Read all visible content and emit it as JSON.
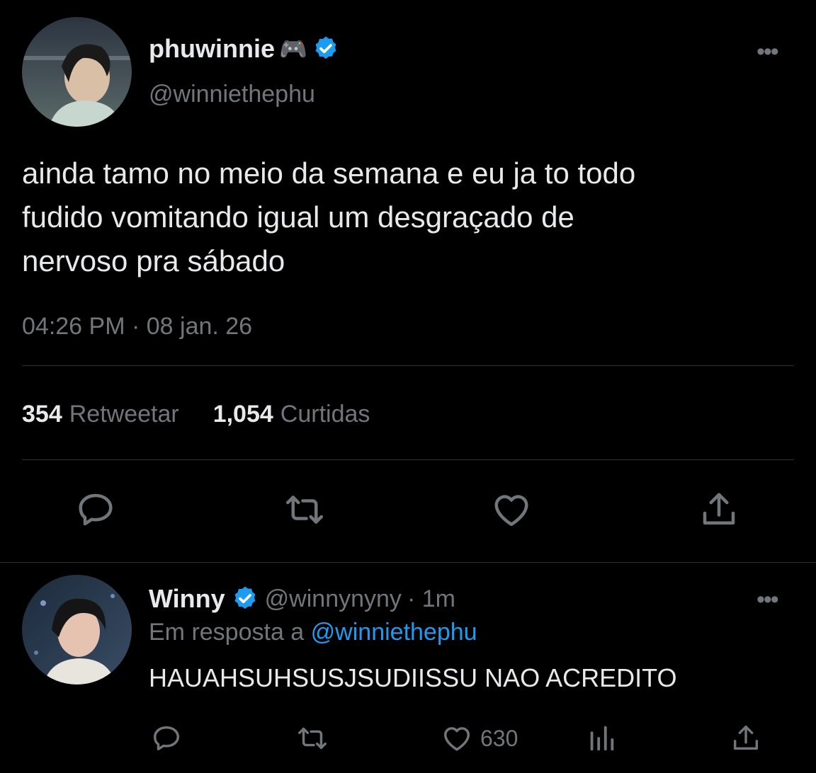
{
  "tweet": {
    "author_name": "phuwinnie",
    "author_emoji": "🎮",
    "author_handle": "@winniethephu",
    "text_line1": "ainda tamo no meio da semana e eu ja to todo",
    "text_line2": "fudido vomitando igual um desgraçado de",
    "text_line3": "nervoso pra sábado",
    "timestamp": "04:26 PM · 08 jan. 26",
    "retweets_count": "354",
    "retweets_label": "Retweetar",
    "likes_count": "1,054",
    "likes_label": "Curtidas",
    "icons": {
      "reply": "reply-icon",
      "retweet": "retweet-icon",
      "like": "heart-icon",
      "share": "share-icon"
    }
  },
  "reply": {
    "author_name": "Winny",
    "author_handle": "@winnynyny",
    "time": "· 1m",
    "reply_to_prefix": "Em resposta a",
    "reply_to_handle": "@winniethephu",
    "text": "HAUAHSUHSUSJSUDIISSU NAO ACREDITO",
    "likes_count": "630",
    "icons": {
      "reply": "reply-icon",
      "retweet": "retweet-icon",
      "like": "heart-icon",
      "analytics": "analytics-icon",
      "share": "share-icon"
    }
  },
  "colors": {
    "background": "#000000",
    "text": "#e7e9ea",
    "muted": "#71767b",
    "accent": "#1d9bf0",
    "divider": "#2f3336"
  }
}
